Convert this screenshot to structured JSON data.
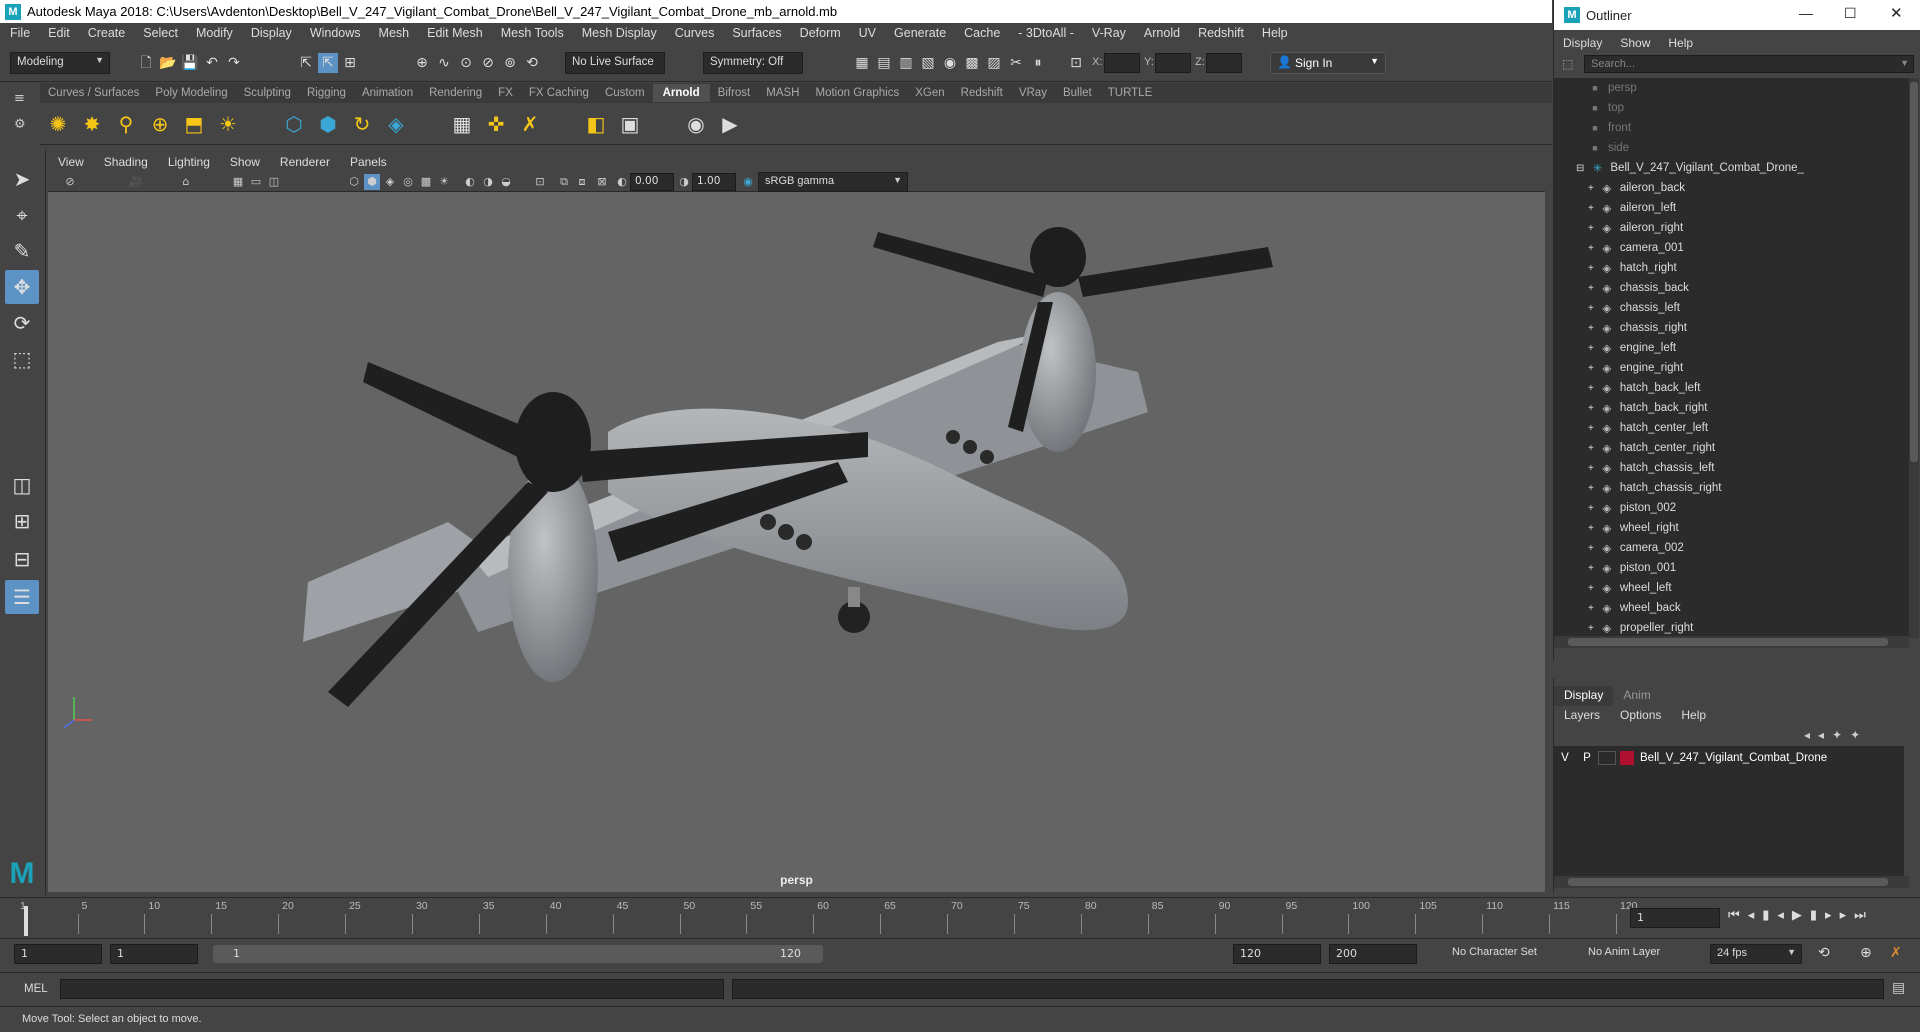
{
  "window": {
    "title": "Autodesk Maya 2018: C:\\Users\\Avdenton\\Desktop\\Bell_V_247_Vigilant_Combat_Drone\\Bell_V_247_Vigilant_Combat_Drone_mb_arnold.mb",
    "logo_letter": "M"
  },
  "menubar": [
    "File",
    "Edit",
    "Create",
    "Select",
    "Modify",
    "Display",
    "Windows",
    "Mesh",
    "Edit Mesh",
    "Mesh Tools",
    "Mesh Display",
    "Curves",
    "Surfaces",
    "Deform",
    "UV",
    "Generate",
    "Cache",
    "- 3DtoAll -",
    "V-Ray",
    "Arnold",
    "Redshift",
    "Help"
  ],
  "statusline": {
    "mode": "Modeling",
    "live_surface": "No Live Surface",
    "symmetry": "Symmetry: Off",
    "x_label": "X:",
    "y_label": "Y:",
    "z_label": "Z:",
    "sign_in": "Sign In"
  },
  "shelf": {
    "tabs": [
      "Curves / Surfaces",
      "Poly Modeling",
      "Sculpting",
      "Rigging",
      "Animation",
      "Rendering",
      "FX",
      "FX Caching",
      "Custom",
      "Arnold",
      "Bifrost",
      "MASH",
      "Motion Graphics",
      "XGen",
      "Redshift",
      "VRay",
      "Bullet",
      "TURTLE"
    ],
    "active_tab": "Arnold"
  },
  "viewport": {
    "menu": [
      "View",
      "Shading",
      "Lighting",
      "Show",
      "Renderer",
      "Panels"
    ],
    "exposure": "0.00",
    "gamma": "1.00",
    "color_space": "sRGB gamma",
    "camera_label": "persp"
  },
  "outliner": {
    "title": "Outliner",
    "menu": [
      "Display",
      "Show",
      "Help"
    ],
    "search_placeholder": "Search...",
    "cameras": [
      "persp",
      "top",
      "front",
      "side"
    ],
    "root": "Bell_V_247_Vigilant_Combat_Drone_",
    "children": [
      "aileron_back",
      "aileron_left",
      "aileron_right",
      "camera_001",
      "hatch_right",
      "chassis_back",
      "chassis_left",
      "chassis_right",
      "engine_left",
      "engine_right",
      "hatch_back_left",
      "hatch_back_right",
      "hatch_center_left",
      "hatch_center_right",
      "hatch_chassis_left",
      "hatch_chassis_right",
      "piston_002",
      "wheel_right",
      "camera_002",
      "piston_001",
      "wheel_left",
      "wheel_back",
      "propeller_right"
    ]
  },
  "layer_editor": {
    "tabs": [
      "Display",
      "Anim"
    ],
    "menu": [
      "Layers",
      "Options",
      "Help"
    ],
    "layer": {
      "v": "V",
      "p": "P",
      "name": "Bell_V_247_Vigilant_Combat_Drone",
      "color": "#b01030"
    }
  },
  "timeline": {
    "ticks": [
      "1",
      "5",
      "10",
      "15",
      "20",
      "25",
      "30",
      "35",
      "40",
      "45",
      "50",
      "55",
      "60",
      "65",
      "70",
      "75",
      "80",
      "85",
      "90",
      "95",
      "100",
      "105",
      "110",
      "115",
      "120"
    ],
    "current_frame": "1"
  },
  "range": {
    "start": "1",
    "playback_start": "1",
    "slider_start": "1",
    "slider_end": "120",
    "playback_end": "120",
    "end": "200",
    "character_set": "No Character Set",
    "anim_layer": "No Anim Layer",
    "fps": "24 fps"
  },
  "cmdline": {
    "label": "MEL"
  },
  "helpline": {
    "text": "Move Tool: Select an object to move."
  },
  "colors": {
    "accent": "#5c92c4",
    "maya_teal": "#1aa3b8",
    "viewport_bg": "#646464"
  }
}
